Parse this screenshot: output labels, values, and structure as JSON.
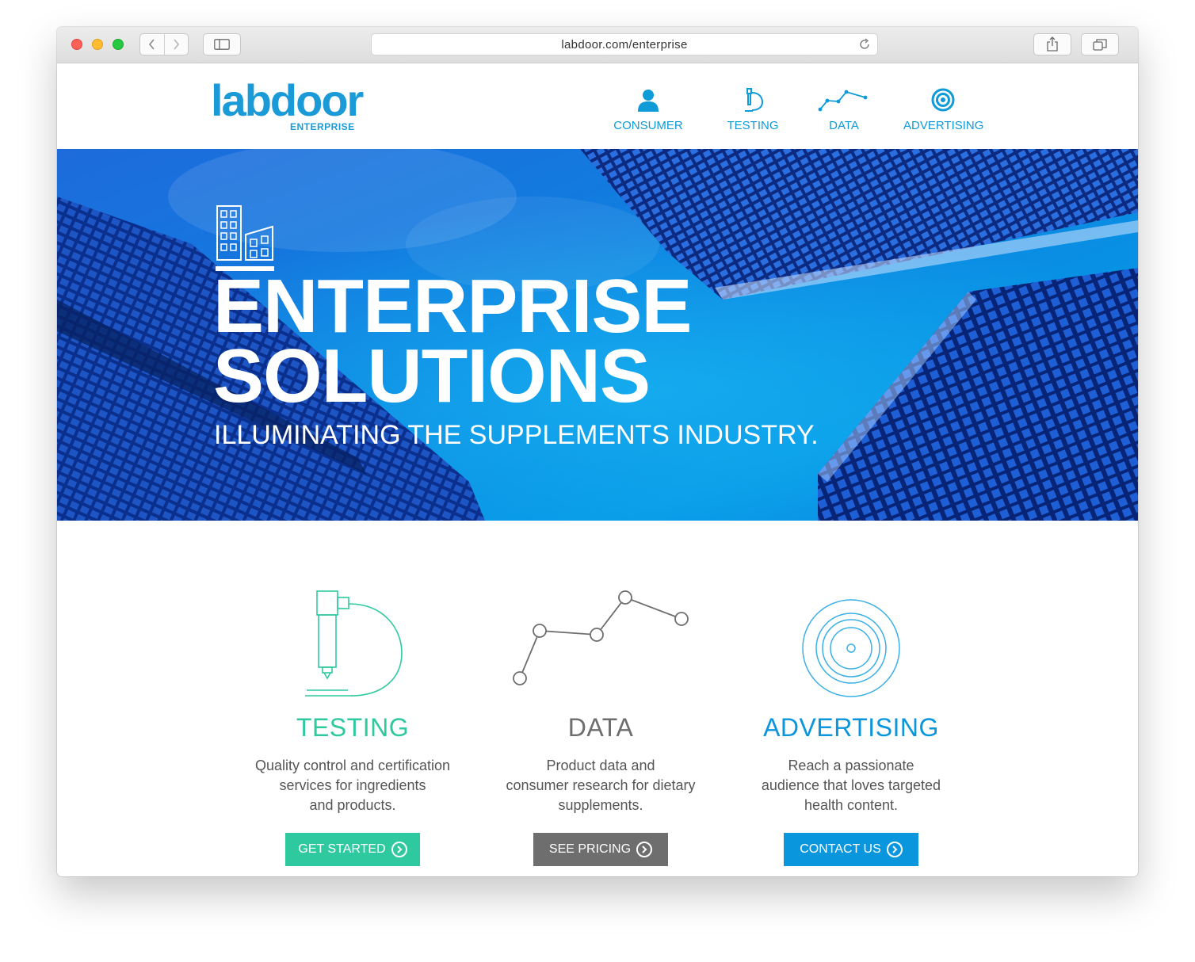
{
  "browser": {
    "url": "labdoor.com/enterprise"
  },
  "site": {
    "logo_text": "labdoor",
    "logo_subtext": "ENTERPRISE",
    "nav": [
      {
        "label": "CONSUMER",
        "icon": "person-icon"
      },
      {
        "label": "TESTING",
        "icon": "microscope-icon"
      },
      {
        "label": "DATA",
        "icon": "line-chart-icon"
      },
      {
        "label": "ADVERTISING",
        "icon": "target-icon"
      }
    ]
  },
  "hero": {
    "title_line1": "ENTERPRISE",
    "title_line2": "SOLUTIONS",
    "subtitle": "ILLUMINATING THE SUPPLEMENTS INDUSTRY."
  },
  "features": [
    {
      "title": "TESTING",
      "desc_lines": [
        "Quality control and certification",
        "services for ingredients",
        "and products."
      ],
      "cta": "GET STARTED",
      "color": "#2fc9a0"
    },
    {
      "title": "DATA",
      "desc_lines": [
        "Product data and",
        "consumer research for dietary",
        "supplements."
      ],
      "cta": "SEE PRICING",
      "color": "#6e6e6e"
    },
    {
      "title": "ADVERTISING",
      "desc_lines": [
        "Reach a passionate",
        "audience that loves targeted",
        "health content."
      ],
      "cta": "CONTACT US",
      "color": "#0a96dd"
    }
  ],
  "colors": {
    "brand_blue": "#1a9ad7",
    "testing_green": "#2fc9a0",
    "data_gray": "#6e6e6e",
    "advertising_blue": "#0a96dd"
  }
}
